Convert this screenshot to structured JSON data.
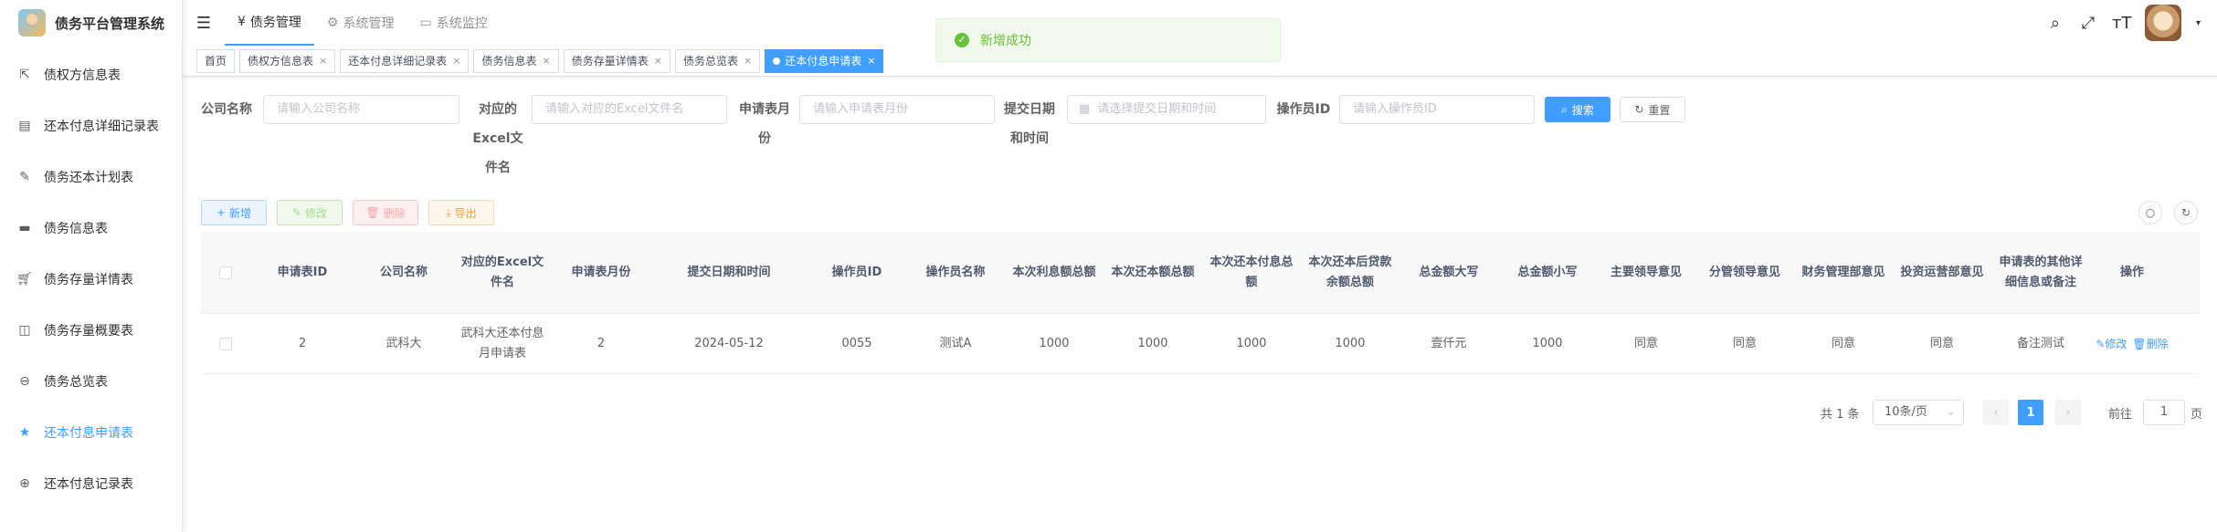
{
  "app": {
    "title": "债务平台管理系统"
  },
  "sidebar": {
    "items": [
      {
        "label": "债权方信息表",
        "icon": "share-icon"
      },
      {
        "label": "还本付息详细记录表",
        "icon": "document-icon"
      },
      {
        "label": "债务还本计划表",
        "icon": "edit-icon"
      },
      {
        "label": "债务信息表",
        "icon": "message-icon"
      },
      {
        "label": "债务存量详情表",
        "icon": "cart-icon"
      },
      {
        "label": "债务存量概要表",
        "icon": "book-icon"
      },
      {
        "label": "债务总览表",
        "icon": "minus-circle-icon"
      },
      {
        "label": "还本付息申请表",
        "icon": "star-icon",
        "active": true
      },
      {
        "label": "还本付息记录表",
        "icon": "plus-circle-icon"
      }
    ]
  },
  "topnav": {
    "items": [
      {
        "label": "债务管理",
        "icon": "yen-icon",
        "active": true
      },
      {
        "label": "系统管理",
        "icon": "gear-icon"
      },
      {
        "label": "系统监控",
        "icon": "monitor-icon"
      }
    ]
  },
  "tags": [
    {
      "label": "首页",
      "closable": false
    },
    {
      "label": "债权方信息表",
      "closable": true
    },
    {
      "label": "还本付息详细记录表",
      "closable": true
    },
    {
      "label": "债务信息表",
      "closable": true
    },
    {
      "label": "债务存量详情表",
      "closable": true
    },
    {
      "label": "债务总览表",
      "closable": true
    },
    {
      "label": "还本付息申请表",
      "closable": true,
      "active": true
    }
  ],
  "toast": {
    "message": "新增成功"
  },
  "search": {
    "company_label": "公司名称",
    "company_placeholder": "请输入公司名称",
    "excel_label_1": "对应的",
    "excel_label_2": "Excel文",
    "excel_label_3": "件名",
    "excel_placeholder": "请输入对应的Excel文件名",
    "month_label_1": "申请表月",
    "month_label_2": "份",
    "month_placeholder": "请输入申请表月份",
    "date_label_1": "提交日期",
    "date_label_2": "和时间",
    "date_placeholder": "请选择提交日期和时间",
    "operator_label": "操作员ID",
    "operator_placeholder": "请输入操作员ID",
    "search_button": "搜索",
    "reset_button": "重置"
  },
  "toolbar": {
    "add": "新增",
    "edit": "修改",
    "delete": "删除",
    "export": "导出"
  },
  "table": {
    "headers": [
      "申请表ID",
      "公司名称",
      "对应的Excel文件名",
      "申请表月份",
      "提交日期和时间",
      "操作员ID",
      "操作员名称",
      "本次利息额总额",
      "本次还本额总额",
      "本次还本付息总额",
      "本次还本后贷款余额总额",
      "总金额大写",
      "总金额小写",
      "主要领导意见",
      "分管领导意见",
      "财务管理部意见",
      "投资运营部意见",
      "申请表的其他详细信息或备注",
      "操作"
    ],
    "rows": [
      {
        "cells": [
          "2",
          "武科大",
          "武科大还本付息月申请表",
          "2",
          "2024-05-12",
          "0055",
          "测试A",
          "1000",
          "1000",
          "1000",
          "1000",
          "壹仟元",
          "1000",
          "同意",
          "同意",
          "同意",
          "同意",
          "备注测试"
        ],
        "edit": "修改",
        "delete": "删除"
      }
    ]
  },
  "pagination": {
    "total": "共 1 条",
    "page_size": "10条/页",
    "current_page": "1",
    "goto_label": "前往",
    "goto_value": "1",
    "page_suffix": "页"
  }
}
